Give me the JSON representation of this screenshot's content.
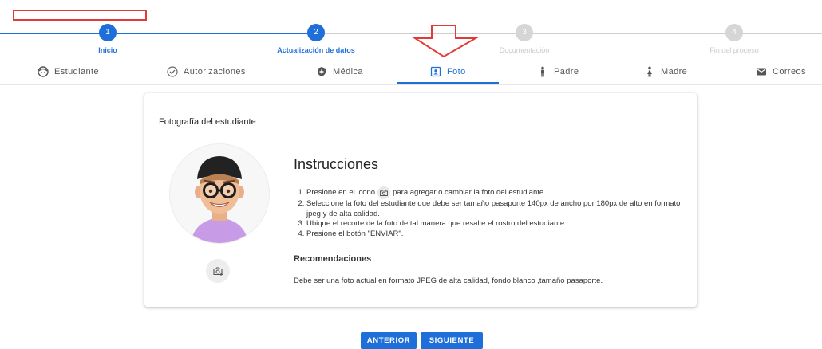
{
  "stepper": {
    "steps": [
      {
        "number": "1",
        "label": "Inicio"
      },
      {
        "number": "2",
        "label": "Actualización de datos"
      },
      {
        "number": "3",
        "label": "Documentación"
      },
      {
        "number": "4",
        "label": "Fin del proceso"
      }
    ]
  },
  "tabs": [
    {
      "label": "Estudiante",
      "icon": "face-icon"
    },
    {
      "label": "Autorizaciones",
      "icon": "check-circle-icon"
    },
    {
      "label": "Médica",
      "icon": "shield-icon"
    },
    {
      "label": "Foto",
      "icon": "portrait-icon"
    },
    {
      "label": "Padre",
      "icon": "man-icon"
    },
    {
      "label": "Madre",
      "icon": "woman-icon"
    },
    {
      "label": "Correos",
      "icon": "mail-icon"
    }
  ],
  "card": {
    "title": "Fotografía del estudiante",
    "instructions_title": "Instrucciones",
    "instructions": [
      {
        "before": "Presione en el icono",
        "after": "para agregar o cambiar la foto del estudiante."
      },
      {
        "text": "Seleccione la foto del estudiante que debe ser tamaño pasaporte 140px de ancho por 180px de alto en formato jpeg y de alta calidad."
      },
      {
        "text": "Ubique el recorte de la foto de tal manera que resalte el rostro del estudiante."
      },
      {
        "text": "Presione el botón \"ENVIAR\"."
      }
    ],
    "recommendations_title": "Recomendaciones",
    "recommendations_text": "Debe ser una foto actual en formato JPEG de alta calidad, fondo blanco ,tamaño pasaporte."
  },
  "buttons": {
    "back": "ANTERIOR",
    "next": "SIGUIENTE"
  },
  "colors": {
    "accent": "#1e6fd9",
    "annotation": "#e53935",
    "inactive": "#d6d6d6"
  }
}
